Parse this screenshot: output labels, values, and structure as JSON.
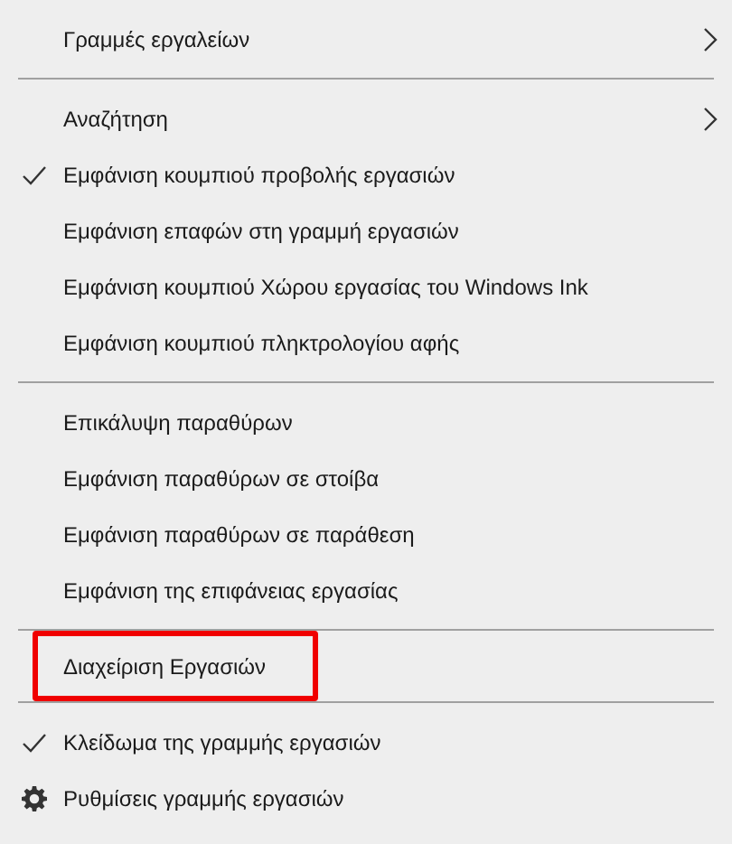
{
  "sections": [
    {
      "items": [
        {
          "kind": "submenu",
          "label": "Γραμμές εργαλείων"
        }
      ]
    },
    {
      "items": [
        {
          "kind": "submenu",
          "label": "Αναζήτηση"
        },
        {
          "kind": "toggle",
          "label": "Εμφάνιση κουμπιού προβολής εργασιών",
          "checked": true
        },
        {
          "kind": "toggle",
          "label": "Εμφάνιση επαφών στη γραμμή εργασιών",
          "checked": false
        },
        {
          "kind": "toggle",
          "label": "Εμφάνιση κουμπιού Χώρου εργασίας του Windows Ink",
          "checked": false
        },
        {
          "kind": "toggle",
          "label": "Εμφάνιση κουμπιού πληκτρολογίου αφής",
          "checked": false
        }
      ]
    },
    {
      "items": [
        {
          "kind": "command",
          "label": "Επικάλυψη παραθύρων"
        },
        {
          "kind": "command",
          "label": "Εμφάνιση παραθύρων σε στοίβα"
        },
        {
          "kind": "command",
          "label": "Εμφάνιση παραθύρων σε παράθεση"
        },
        {
          "kind": "command",
          "label": "Εμφάνιση της επιφάνειας εργασίας"
        }
      ]
    },
    {
      "items": [
        {
          "kind": "command",
          "label": "Διαχείριση Εργασιών",
          "highlighted": true
        }
      ]
    },
    {
      "items": [
        {
          "kind": "toggle",
          "label": "Κλείδωμα της γραμμής εργασιών",
          "checked": true
        },
        {
          "kind": "settings",
          "label": "Ρυθμίσεις γραμμής εργασιών"
        }
      ]
    }
  ]
}
